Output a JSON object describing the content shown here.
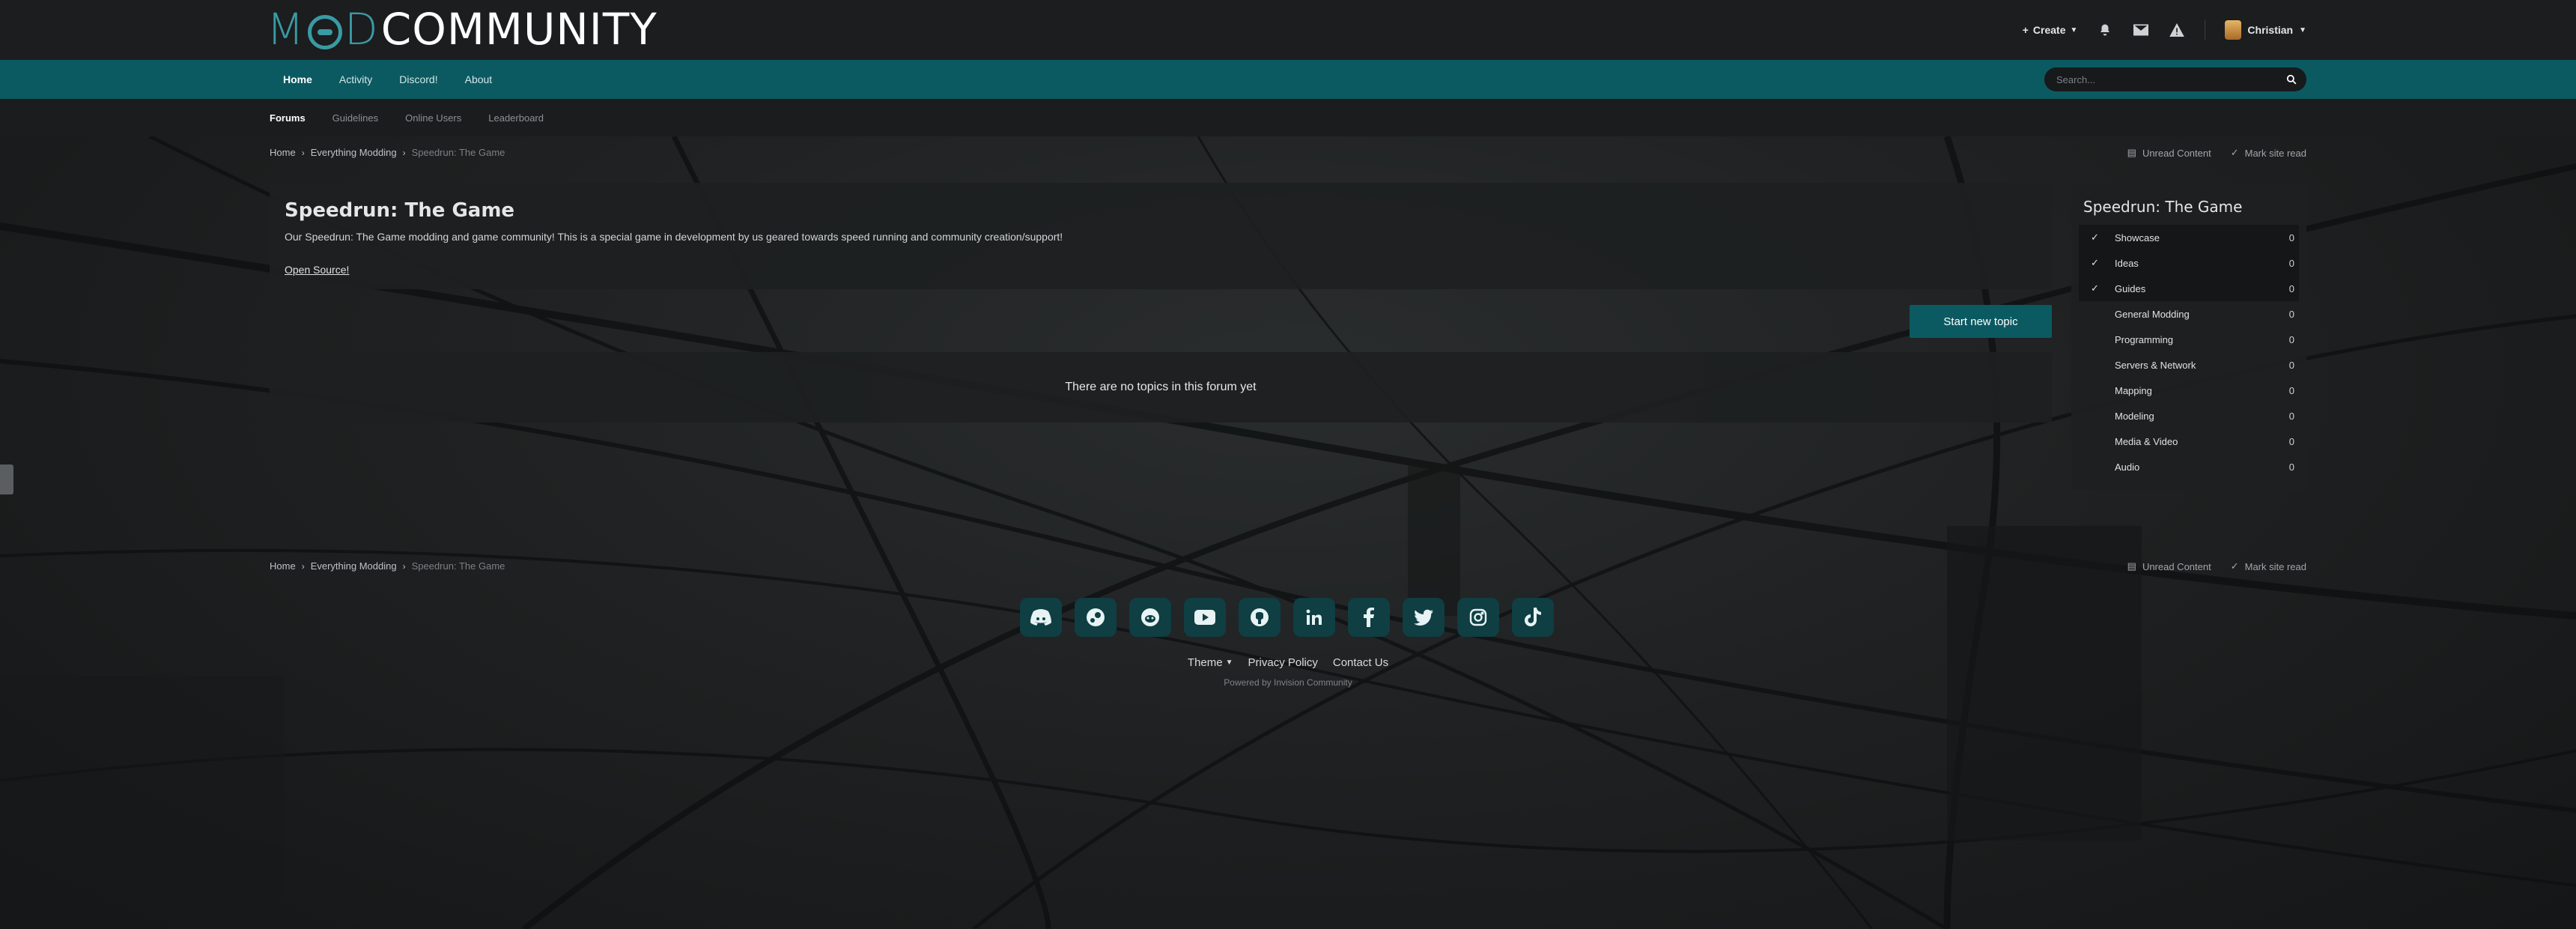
{
  "header": {
    "logo_mod": "MOD",
    "logo_community": "COMMUNITY",
    "create_label": "Create",
    "user_name": "Christian"
  },
  "primary_nav": {
    "items": [
      "Home",
      "Activity",
      "Discord!",
      "About"
    ]
  },
  "search": {
    "placeholder": "Search..."
  },
  "secondary_nav": {
    "items": [
      "Forums",
      "Guidelines",
      "Online Users",
      "Leaderboard"
    ]
  },
  "breadcrumb": {
    "home": "Home",
    "parent": "Everything Modding",
    "current": "Speedrun: The Game"
  },
  "crumb_actions": {
    "unread": "Unread Content",
    "mark_read": "Mark site read"
  },
  "forum": {
    "title": "Speedrun: The Game",
    "description": "Our Speedrun: The Game modding and game community! This is a special game in development by us geared towards speed running and community creation/support!",
    "link": "Open Source!",
    "start_topic": "Start new topic",
    "empty_message": "There are no topics in this forum yet"
  },
  "sidebar": {
    "title": "Speedrun: The Game",
    "items": [
      {
        "label": "Showcase",
        "count": "0",
        "checked": true
      },
      {
        "label": "Ideas",
        "count": "0",
        "checked": true
      },
      {
        "label": "Guides",
        "count": "0",
        "checked": true
      },
      {
        "label": "General Modding",
        "count": "0",
        "checked": false
      },
      {
        "label": "Programming",
        "count": "0",
        "checked": false
      },
      {
        "label": "Servers & Network",
        "count": "0",
        "checked": false
      },
      {
        "label": "Mapping",
        "count": "0",
        "checked": false
      },
      {
        "label": "Modeling",
        "count": "0",
        "checked": false
      },
      {
        "label": "Media & Video",
        "count": "0",
        "checked": false
      },
      {
        "label": "Audio",
        "count": "0",
        "checked": false
      }
    ]
  },
  "footer": {
    "social_icons": [
      "discord-icon",
      "steam-icon",
      "reddit-icon",
      "youtube-icon",
      "github-icon",
      "linkedin-icon",
      "facebook-icon",
      "twitter-icon",
      "instagram-icon",
      "tiktok-icon"
    ],
    "theme": "Theme",
    "privacy": "Privacy Policy",
    "contact": "Contact Us",
    "powered": "Powered by Invision Community"
  },
  "colors": {
    "accent": "#0b5a61",
    "logo_teal": "#3a9aa3",
    "header_bg": "#1b1d1f"
  }
}
